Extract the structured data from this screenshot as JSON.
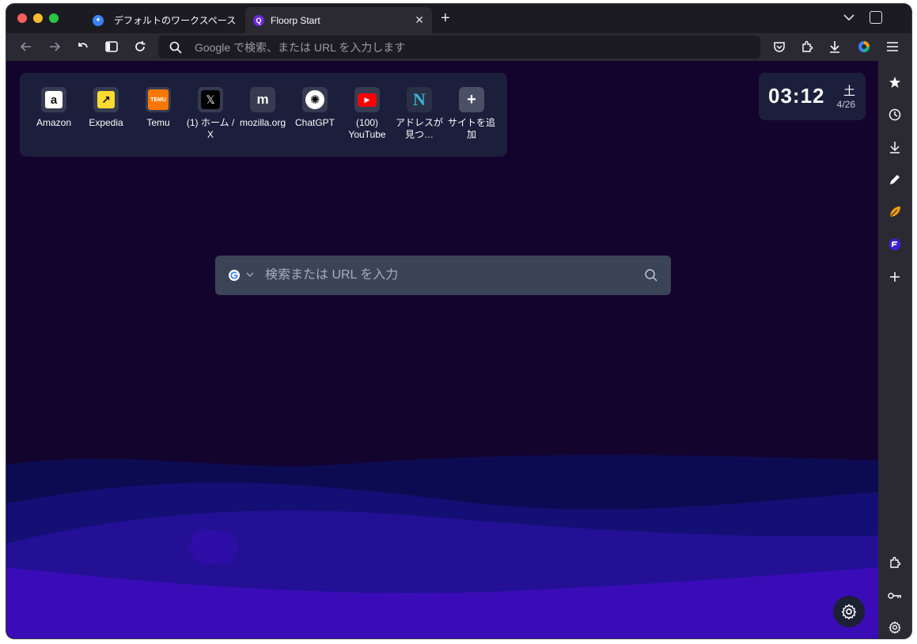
{
  "tabs": [
    {
      "label": "デフォルトのワークスペース",
      "favicon": "workspace-icon"
    },
    {
      "label": "Floorp Start",
      "favicon": "floorp-icon",
      "close": "✕"
    }
  ],
  "new_tab": "+",
  "urlbar": {
    "placeholder": "Google で検索、または URL を入力します"
  },
  "shortcuts": [
    {
      "name": "Amazon",
      "icon": "amazon-icon",
      "glyph": "a"
    },
    {
      "name": "Expedia",
      "icon": "expedia-icon",
      "glyph": "↗"
    },
    {
      "name": "Temu",
      "icon": "temu-icon",
      "glyph": "TEMU"
    },
    {
      "name": "(1) ホーム / X",
      "icon": "x-icon",
      "glyph": "𝕏"
    },
    {
      "name": "mozilla.org",
      "icon": "mozilla-icon",
      "glyph": "m"
    },
    {
      "name": "ChatGPT",
      "icon": "chatgpt-icon",
      "glyph": "✺"
    },
    {
      "name": "(100) YouTube",
      "icon": "youtube-icon",
      "glyph": "▶"
    },
    {
      "name": "アドレスが見つ…",
      "icon": "notion-icon",
      "glyph": "N"
    },
    {
      "name": "サイトを追加",
      "icon": "add-site-icon",
      "glyph": "+"
    }
  ],
  "clock": {
    "time": "03:12",
    "weekday": "土",
    "date": "4/26"
  },
  "search": {
    "placeholder": "検索または URL を入力",
    "engine": "google-icon"
  },
  "colors": {
    "background": "#13042e",
    "accent": "#3a0cb8",
    "panel": "#1b1f3b"
  }
}
